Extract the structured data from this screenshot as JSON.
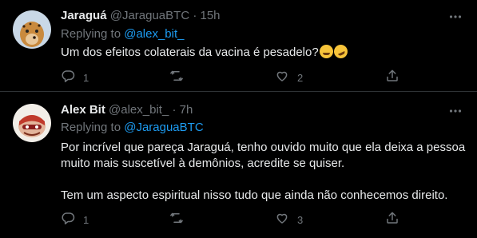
{
  "tweets": [
    {
      "name": "Jaraguá",
      "handle": "@JaraguaBTC",
      "separator": "·",
      "time": "15h",
      "replying_prefix": "Replying to",
      "replying_to": "@alex_bit_",
      "text_lines": [
        "Um dos efeitos colaterais da vacina é pesadelo?"
      ],
      "emojis": [
        "face-with-tears-of-joy",
        "rolling-on-the-floor-laughing"
      ],
      "replies": "1",
      "retweets": "",
      "likes": "2"
    },
    {
      "name": "Alex Bit",
      "handle": "@alex_bit_",
      "separator": "·",
      "time": "7h",
      "replying_prefix": "Replying to",
      "replying_to": "@JaraguaBTC",
      "text_lines": [
        "Por incrível que pareça Jaraguá, tenho ouvido muito que ela deixa a pessoa",
        "muito mais suscetível à demônios, acredite se quiser.",
        "",
        "Tem um aspecto espiritual nisso tudo que ainda não conhecemos direito."
      ],
      "replies": "1",
      "retweets": "",
      "likes": "3"
    }
  ],
  "colors": {
    "background": "#000000",
    "text": "#e7e9ea",
    "secondary": "#71767b",
    "link": "#1d9bf0",
    "divider": "#2f3336"
  },
  "icons": [
    "more-icon",
    "reply-icon",
    "retweet-icon",
    "like-icon",
    "share-icon"
  ]
}
